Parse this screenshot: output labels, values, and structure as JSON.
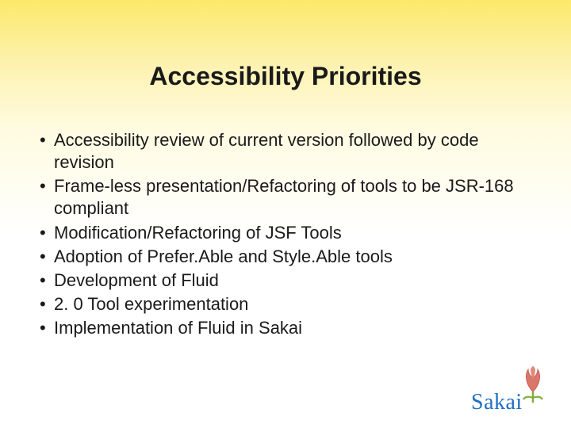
{
  "title": "Accessibility Priorities",
  "bullets": [
    "Accessibility review of current version followed by code revision",
    "Frame-less presentation/Refactoring of tools to be JSR-168 compliant",
    "Modification/Refactoring of JSF Tools",
    "Adoption of Prefer.Able and Style.Able tools",
    "Development of Fluid",
    "2. 0 Tool experimentation",
    "Implementation of Fluid in Sakai"
  ],
  "logo": {
    "text": "Sakai"
  }
}
